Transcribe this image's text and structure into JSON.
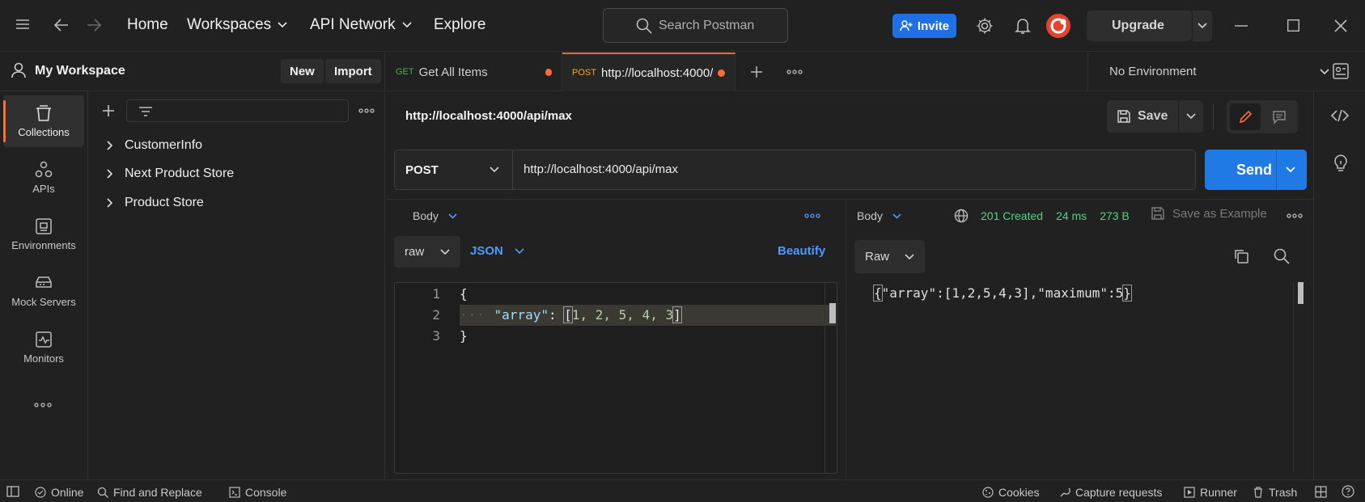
{
  "topbar": {
    "nav": [
      "Home",
      "Workspaces",
      "API Network",
      "Explore"
    ],
    "search_placeholder": "Search Postman",
    "invite_label": "Invite",
    "upgrade_label": "Upgrade"
  },
  "workspace": {
    "title": "My Workspace",
    "new_label": "New",
    "import_label": "Import"
  },
  "rail": {
    "items": [
      {
        "label": "Collections",
        "icon": "collections-icon"
      },
      {
        "label": "APIs",
        "icon": "apis-icon"
      },
      {
        "label": "Environments",
        "icon": "environments-icon"
      },
      {
        "label": "Mock Servers",
        "icon": "mock-servers-icon"
      },
      {
        "label": "Monitors",
        "icon": "monitors-icon"
      }
    ]
  },
  "collections": [
    "CustomerInfo",
    "Next Product Store",
    "Product Store"
  ],
  "tabs": [
    {
      "method": "GET",
      "label": "Get All Items",
      "method_color": "#4caf50"
    },
    {
      "method": "POST",
      "label": "http://localhost:4000/",
      "method_color": "#f5a623"
    }
  ],
  "environment": "No Environment",
  "request": {
    "title": "http://localhost:4000/api/max",
    "save_label": "Save",
    "method": "POST",
    "url": "http://localhost:4000/api/max",
    "send_label": "Send",
    "body_label": "Body",
    "body_mode": "raw",
    "body_format": "JSON",
    "beautify_label": "Beautify",
    "line_numbers": [
      "1",
      "2",
      "3"
    ],
    "code": {
      "open": "{",
      "key": "\"array\"",
      "colon": ": ",
      "bracket_open": "[",
      "values": "1, 2, 5, 4, 3",
      "bracket_close": "]",
      "close": "}"
    }
  },
  "response": {
    "body_label": "Body",
    "status": "201 Created",
    "time": "24 ms",
    "size": "273 B",
    "save_example_label": "Save as Example",
    "view_mode": "Raw",
    "brace_open": "{",
    "content": "\"array\":[1,2,5,4,3],\"maximum\":5",
    "brace_close": "}"
  },
  "statusbar": {
    "online": "Online",
    "find_replace": "Find and Replace",
    "console": "Console",
    "cookies": "Cookies",
    "capture": "Capture requests",
    "runner": "Runner",
    "trash": "Trash"
  },
  "colors": {
    "accent": "#ff6c37",
    "primary": "#1f7ae6",
    "link": "#4c9aff",
    "success": "#58d183"
  }
}
